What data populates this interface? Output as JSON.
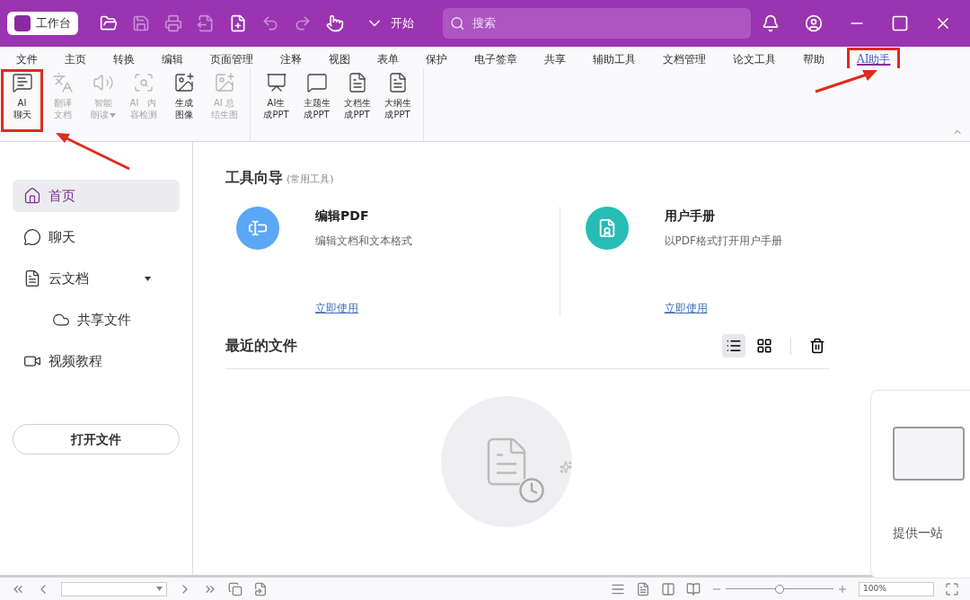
{
  "titlebar": {
    "workspace": "工作台",
    "start": "开始",
    "search_placeholder": "搜索"
  },
  "menu": [
    {
      "label": "文件",
      "selected": false,
      "highlighted": false
    },
    {
      "label": "主页",
      "selected": false,
      "highlighted": false
    },
    {
      "label": "转换",
      "selected": false,
      "highlighted": false
    },
    {
      "label": "编辑",
      "selected": false,
      "highlighted": false
    },
    {
      "label": "页面管理",
      "selected": false,
      "highlighted": false
    },
    {
      "label": "注释",
      "selected": false,
      "highlighted": false
    },
    {
      "label": "视图",
      "selected": false,
      "highlighted": false
    },
    {
      "label": "表单",
      "selected": false,
      "highlighted": false
    },
    {
      "label": "保护",
      "selected": false,
      "highlighted": false
    },
    {
      "label": "电子签章",
      "selected": false,
      "highlighted": false
    },
    {
      "label": "共享",
      "selected": false,
      "highlighted": false
    },
    {
      "label": "辅助工具",
      "selected": false,
      "highlighted": false
    },
    {
      "label": "文档管理",
      "selected": false,
      "highlighted": false
    },
    {
      "label": "论文工具",
      "selected": false,
      "highlighted": false
    },
    {
      "label": "帮助",
      "selected": false,
      "highlighted": false
    },
    {
      "label": "AI助手",
      "selected": true,
      "highlighted": true
    }
  ],
  "ribbon": [
    [
      {
        "kind": "chat",
        "lines": [
          "AI",
          "聊天"
        ],
        "disabled": false,
        "highlighted": true,
        "dropdown": false
      },
      {
        "kind": "translate",
        "lines": [
          "翻译",
          "文档"
        ],
        "disabled": true,
        "highlighted": false,
        "dropdown": false
      },
      {
        "kind": "speaker",
        "lines": [
          "智能",
          "朗读"
        ],
        "disabled": true,
        "highlighted": false,
        "dropdown": true
      },
      {
        "kind": "detect",
        "lines": [
          "AI　内",
          "容检测"
        ],
        "disabled": true,
        "highlighted": false,
        "dropdown": false
      },
      {
        "kind": "image",
        "lines": [
          "生成",
          "图像"
        ],
        "disabled": false,
        "highlighted": false,
        "dropdown": false
      },
      {
        "kind": "image",
        "lines": [
          "AI 总",
          "结生图"
        ],
        "disabled": true,
        "highlighted": false,
        "dropdown": false
      }
    ],
    [
      {
        "kind": "ppt",
        "lines": [
          "AI生",
          "成PPT"
        ],
        "disabled": false,
        "highlighted": false,
        "dropdown": false
      },
      {
        "kind": "bubble",
        "lines": [
          "主题生",
          "成PPT"
        ],
        "disabled": false,
        "highlighted": false,
        "dropdown": false
      },
      {
        "kind": "doc",
        "lines": [
          "文档生",
          "成PPT"
        ],
        "disabled": false,
        "highlighted": false,
        "dropdown": false
      },
      {
        "kind": "doc",
        "lines": [
          "大纲生",
          "成PPT"
        ],
        "disabled": false,
        "highlighted": false,
        "dropdown": false
      }
    ]
  ],
  "sidebar": {
    "items": [
      {
        "kind": "home",
        "label": "首页",
        "selected": true
      },
      {
        "kind": "chat",
        "label": "聊天",
        "selected": false
      },
      {
        "kind": "doc",
        "label": "云文档",
        "selected": false,
        "expanded": true,
        "children": [
          {
            "kind": "cloud",
            "label": "共享文件",
            "selected": false
          }
        ]
      },
      {
        "kind": "video",
        "label": "视频教程",
        "selected": false
      }
    ],
    "open_button": "打开文件"
  },
  "tools": {
    "title": "工具向导",
    "subtitle": "(常用工具)",
    "cards": [
      {
        "kind": "edit",
        "color": "#5aa7f5",
        "title": "编辑PDF",
        "desc": "编辑文档和文本格式",
        "link": "立即使用"
      },
      {
        "kind": "manual",
        "color": "#26bdb5",
        "title": "用户手册",
        "desc": "以PDF格式打开用户手册",
        "link": "立即使用"
      }
    ]
  },
  "recent": {
    "title": "最近的文件",
    "views": [
      {
        "kind": "list",
        "selected": true
      },
      {
        "kind": "grid",
        "selected": false
      }
    ]
  },
  "promo": {
    "title": "提供一站"
  },
  "statusbar": {
    "zoom": {
      "level": 0.5
    },
    "zoom_value": "100%"
  }
}
